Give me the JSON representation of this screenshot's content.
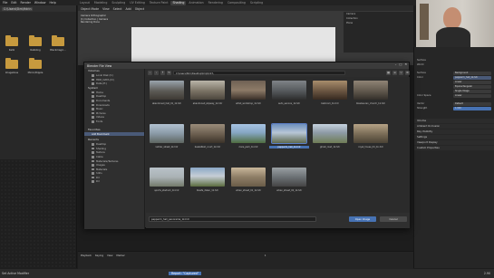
{
  "menu": [
    "File",
    "Edit",
    "Render",
    "Window",
    "Help"
  ],
  "workspaces": [
    "Layout",
    "Modeling",
    "Sculpting",
    "UV Editing",
    "Texture Paint",
    "Shading",
    "Animation",
    "Rendering",
    "Compositing",
    "Scripting"
  ],
  "active_workspace": "Shading",
  "left_panel": {
    "path_label": "C:\\Users\\Stm\\Hdrin",
    "folders": [
      {
        "label": "Kalik"
      },
      {
        "label": "Rubbling"
      },
      {
        "label": "Blackmagic..."
      },
      {
        "label": "Imagelines"
      },
      {
        "label": "Mirror/Ripple"
      }
    ]
  },
  "viewport": {
    "header": [
      "Object Mode",
      "View",
      "Select",
      "Add",
      "Object"
    ],
    "overlay_lines": [
      "Camera Orthographic",
      "(1) Collection | Camera",
      "Rendering Done"
    ]
  },
  "outliner_rows": [
    "Camera",
    "Collection",
    "Plane"
  ],
  "dialog": {
    "title": "Blender File View",
    "path": "C:\\Users\\Stm\\Desktop\\tmp\\hdri\\",
    "volumes_header": "Volumes",
    "volumes": [
      "Local Disk (C:)",
      "HDD_DATA (D:)",
      "Data (E:)"
    ],
    "system_header": "System",
    "system_items": [
      "Home",
      "Desktop",
      "Documents",
      "Downloads",
      "Music",
      "Pictures",
      "Videos",
      "Fonts"
    ],
    "favorites_header": "Favorites",
    "favorites_selected": "Add Bookmark",
    "recent_header": "Recents",
    "recent_items": [
      "Desktop",
      "Shading",
      "Texture",
      "Cable",
      "Materials/Textures",
      "Images",
      "Materials",
      "hdris",
      "Dir",
      "Dir"
    ],
    "thumbs": [
      {
        "label": "abandoned_hall_01_1k.hdr"
      },
      {
        "label": "abandoned_slipway_1k.hdr"
      },
      {
        "label": "artist_workshop_1k.hdr"
      },
      {
        "label": "auto_service_1k.hdr"
      },
      {
        "label": "ballroom_1k.hdr"
      },
      {
        "label": "blaubeuren_church_1k.hdr"
      },
      {
        "label": "ladder_street_1k.hdr"
      },
      {
        "label": "basketball_court_1k.hdr"
      },
      {
        "label": "clare_park_1k.hdr"
      },
      {
        "label": "pepperm_hall_1k.hdr"
      },
      {
        "label": "ghost_road_1k.hdr"
      },
      {
        "label": "royal_house_01_1k.hdr"
      },
      {
        "label": "sports_stadium_1k.hdr"
      },
      {
        "label": "blasfe_dalen_1k.hdr"
      },
      {
        "label": "urban_street_01_1k.hdr"
      },
      {
        "label": "urban_street_02_1k.hdr"
      }
    ],
    "filename": "pepperm_hall_panorama_1k.hdr",
    "open_label": "Open Image",
    "cancel_label": "Cancel"
  },
  "props": {
    "tabs": [
      "Surface",
      "World"
    ],
    "rows": [
      {
        "label": "Surface",
        "value": "Background"
      },
      {
        "label": "Color",
        "value": "pepperm_hall_1k.hdr"
      },
      {
        "label": "Linear",
        "value": "Linear"
      },
      {
        "label": "Equirectangular",
        "value": "Equirectangular"
      },
      {
        "label": "Single Image",
        "value": "Single Image"
      },
      {
        "label": "Color Space",
        "value": "Linear"
      },
      {
        "label": "Vector",
        "value": "Default"
      },
      {
        "label": "Strength",
        "value": "1.000"
      }
    ],
    "sections": [
      "Volume",
      "Ambient Occlusion",
      "Ray Visibility",
      "Settings",
      "Viewport Display",
      "Custom Properties"
    ]
  },
  "timeline": {
    "playback": "Playback",
    "keying": "Keying",
    "view": "View",
    "marker": "Marker",
    "frame": "1"
  },
  "status": {
    "left": "Set Active Modifier",
    "center": "Report: \"Captured\"",
    "right": "2.90"
  }
}
